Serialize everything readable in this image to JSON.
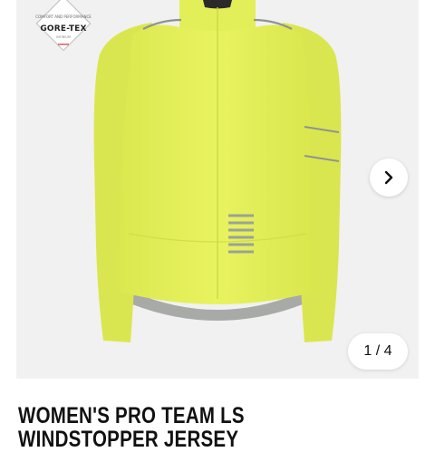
{
  "badge": {
    "tagline": "COMFORT AND PERFORMANCE",
    "brand": "GORE-TEX",
    "fine_print": "INFINIUM"
  },
  "gallery": {
    "counter": "1 / 4",
    "next_icon": "chevron-right-icon"
  },
  "product": {
    "title_line1": "WOMEN'S PRO TEAM LS",
    "title_line2": "WINDSTOPPER JERSEY"
  },
  "colors": {
    "jersey": "#e6f15c",
    "background": "#f1f1f1",
    "reflective": "#8e9490"
  }
}
